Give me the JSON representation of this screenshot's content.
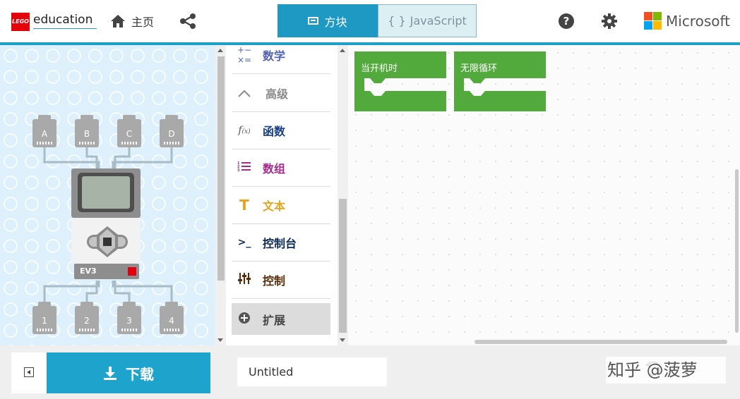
{
  "header": {
    "logo_brand": "LEGO",
    "logo_text": "education",
    "home_label": "主页",
    "tabs": [
      {
        "label": "方块",
        "active": true
      },
      {
        "label": "JavaScript",
        "active": false,
        "prefix": "{ }"
      }
    ],
    "help_glyph": "?",
    "brand_text": "Microsoft",
    "brand_colors": [
      "#f25022",
      "#7fba00",
      "#00a4ef",
      "#ffb900"
    ]
  },
  "simulator": {
    "sensor_ports": [
      "A",
      "B",
      "C",
      "D"
    ],
    "motor_ports": [
      "1",
      "2",
      "3",
      "4"
    ],
    "brick_label": "EV3"
  },
  "toolbox": {
    "items": [
      {
        "icon": "+−×=",
        "label": "数学",
        "color": "#5263b3"
      },
      {
        "icon": "^",
        "label": "高级",
        "color": "#8a8a8a"
      },
      {
        "icon": "f(x)",
        "label": "函数",
        "color": "#1a3f8a"
      },
      {
        "icon": "≡",
        "label": "数组",
        "color": "#a52a8e"
      },
      {
        "icon": "T",
        "label": "文本",
        "color": "#e5a41f"
      },
      {
        "icon": ">_",
        "label": "控制台",
        "color": "#0d2a55"
      },
      {
        "icon": "⫶",
        "label": "控制",
        "color": "#5a2c0a"
      },
      {
        "icon": "+",
        "label": "扩展",
        "color": "#444444"
      }
    ]
  },
  "workspace": {
    "blocks": [
      {
        "label": "当开机时",
        "color": "#52a93c"
      },
      {
        "label": "无限循环",
        "color": "#52a93c"
      }
    ]
  },
  "bottom": {
    "download_label": "下载",
    "project_name": "Untitled",
    "watermark": "知乎 @菠萝"
  },
  "accent_color": "#1c9fc8"
}
